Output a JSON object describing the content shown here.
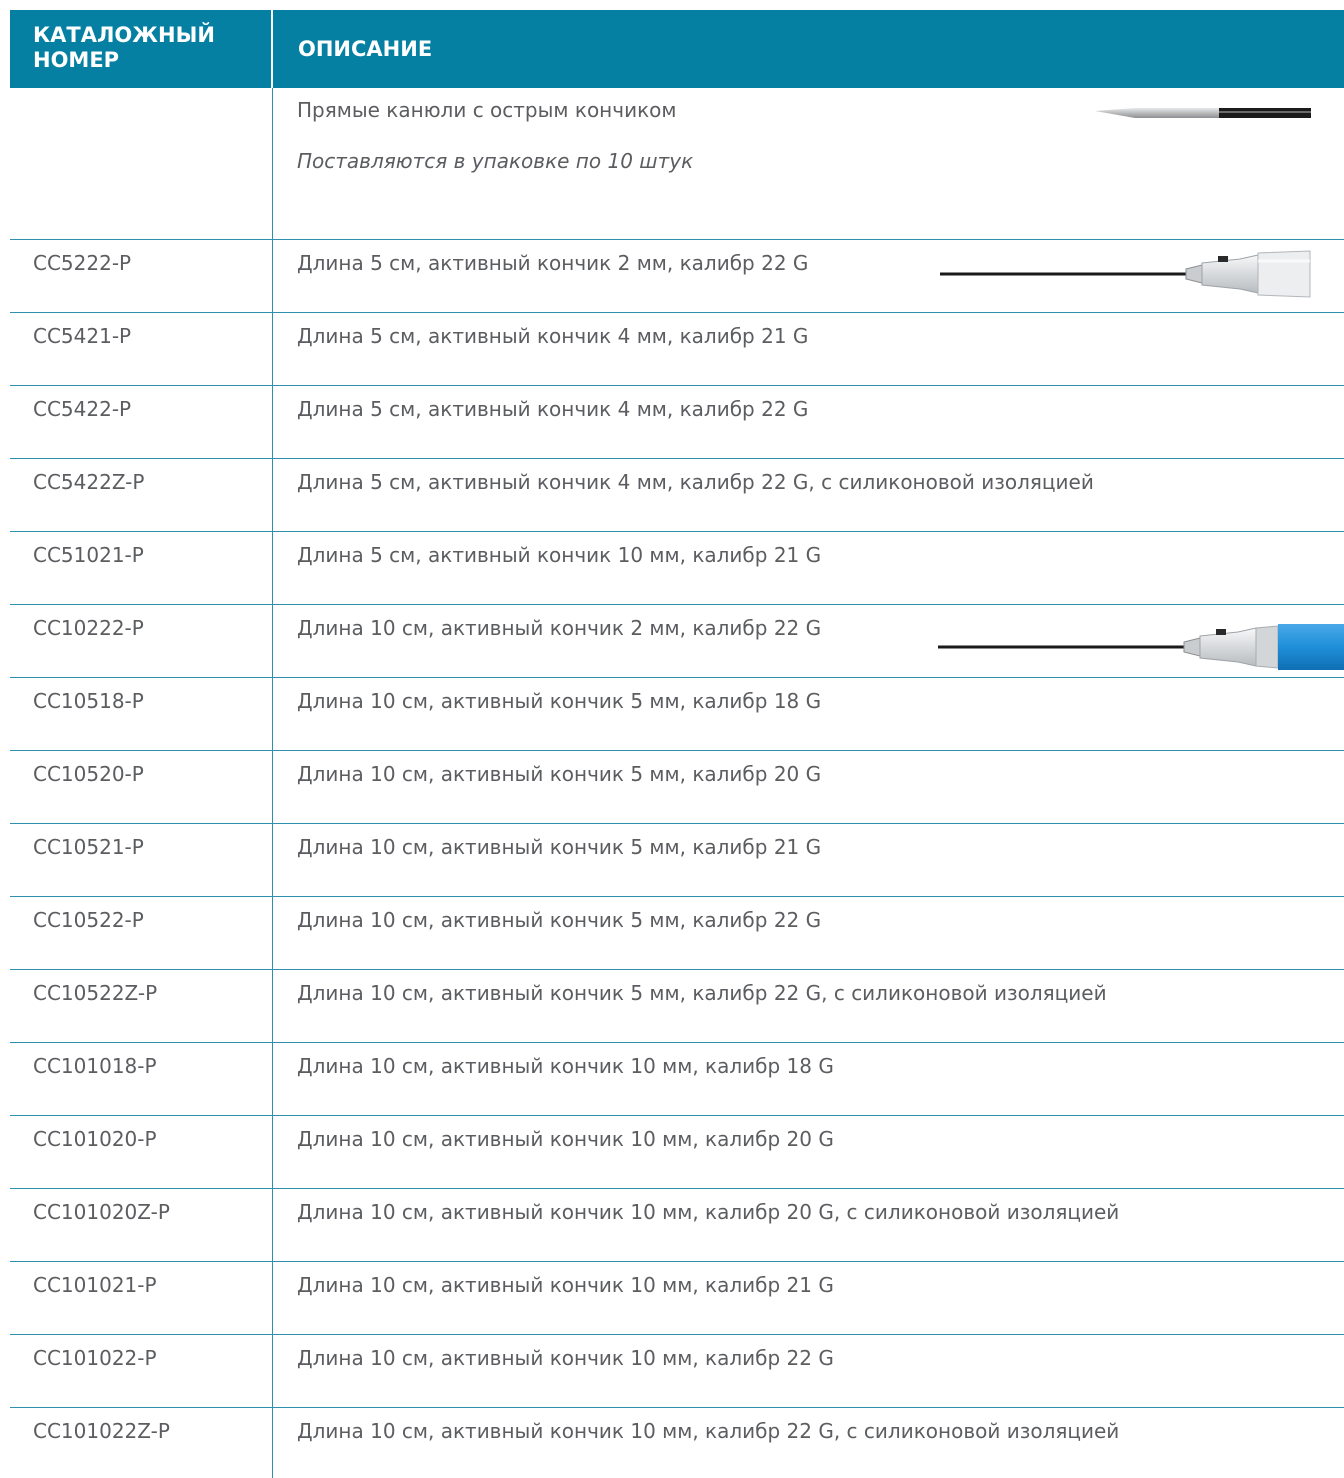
{
  "header": {
    "col1": "КАТАЛОЖНЫЙ НОМЕР",
    "col2": "ОПИСАНИЕ"
  },
  "intro": {
    "title": "Прямые канюли с острым кончиком",
    "note": "Поставляются в упаковке по 10 штук"
  },
  "rows": [
    {
      "code": "CC5222-P",
      "desc": "Длина 5 см, активный кончик 2 мм, калибр 22 G"
    },
    {
      "code": "CC5421-P",
      "desc": "Длина 5 см, активный кончик 4 мм, калибр 21 G"
    },
    {
      "code": "CC5422-P",
      "desc": "Длина 5 см, активный кончик 4 мм, калибр 22 G"
    },
    {
      "code": "CC5422Z-P",
      "desc": "Длина 5 см, активный кончик 4 мм, калибр 22 G, с силиконовой изоляцией"
    },
    {
      "code": "CC51021-P",
      "desc": "Длина 5 см, активный кончик 10 мм, калибр 21 G"
    },
    {
      "code": "CC10222-P",
      "desc": "Длина 10 см, активный кончик 2 мм, калибр 22 G"
    },
    {
      "code": "CC10518-P",
      "desc": "Длина 10 см, активный кончик 5 мм, калибр 18 G"
    },
    {
      "code": "CC10520-P",
      "desc": "Длина 10 см, активный кончик 5 мм, калибр 20 G"
    },
    {
      "code": "CC10521-P",
      "desc": "Длина 10 см, активный кончик 5 мм, калибр 21 G"
    },
    {
      "code": "CC10522-P",
      "desc": "Длина 10 см, активный кончик 5 мм, калибр 22 G"
    },
    {
      "code": "CC10522Z-P",
      "desc": "Длина 10 см, активный кончик 5 мм, калибр 22 G, с силиконовой изоляцией"
    },
    {
      "code": "CC101018-P",
      "desc": "Длина 10 см, активный кончик 10 мм, калибр 18 G"
    },
    {
      "code": "CC101020-P",
      "desc": "Длина 10 см, активный кончик 10 мм, калибр 20 G"
    },
    {
      "code": "CC101020Z-P",
      "desc": "Длина 10 см, активный кончик 10 мм, калибр 20 G, с силиконовой изоляцией"
    },
    {
      "code": "CC101021-P",
      "desc": "Длина 10 см, активный кончик 10 мм, калибр 21 G"
    },
    {
      "code": "CC101022-P",
      "desc": "Длина 10 см, активный кончик 10 мм, калибр 22 G"
    },
    {
      "code": "CC101022Z-P",
      "desc": "Длина 10 см, активный кончик 10 мм, калибр 22 G, с силиконовой изоляцией"
    }
  ],
  "images": {
    "cannula_tip": "cannula-tip-image",
    "cannula_5cm": "cannula-clear-hub-image",
    "cannula_10cm": "cannula-blue-hub-image"
  },
  "colors": {
    "header_bg": "#0580a3",
    "rule": "#2f8fae",
    "text": "#5b5d60",
    "hub_blue": "#1f8fd8"
  }
}
